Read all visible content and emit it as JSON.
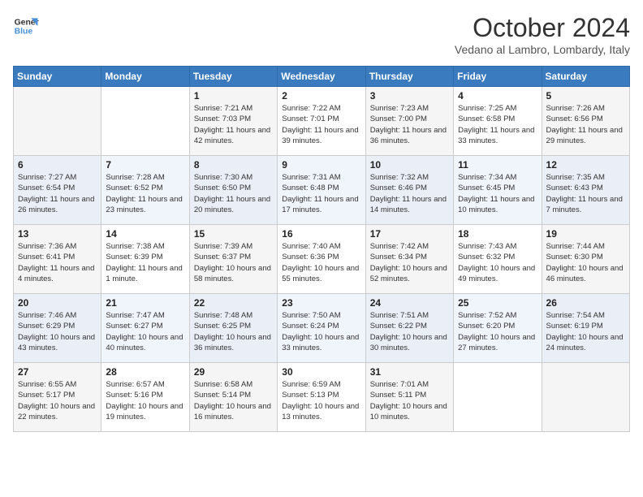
{
  "header": {
    "logo_line1": "General",
    "logo_line2": "Blue",
    "month": "October 2024",
    "location": "Vedano al Lambro, Lombardy, Italy"
  },
  "days_of_week": [
    "Sunday",
    "Monday",
    "Tuesday",
    "Wednesday",
    "Thursday",
    "Friday",
    "Saturday"
  ],
  "weeks": [
    [
      {
        "day": "",
        "info": ""
      },
      {
        "day": "",
        "info": ""
      },
      {
        "day": "1",
        "info": "Sunrise: 7:21 AM\nSunset: 7:03 PM\nDaylight: 11 hours and 42 minutes."
      },
      {
        "day": "2",
        "info": "Sunrise: 7:22 AM\nSunset: 7:01 PM\nDaylight: 11 hours and 39 minutes."
      },
      {
        "day": "3",
        "info": "Sunrise: 7:23 AM\nSunset: 7:00 PM\nDaylight: 11 hours and 36 minutes."
      },
      {
        "day": "4",
        "info": "Sunrise: 7:25 AM\nSunset: 6:58 PM\nDaylight: 11 hours and 33 minutes."
      },
      {
        "day": "5",
        "info": "Sunrise: 7:26 AM\nSunset: 6:56 PM\nDaylight: 11 hours and 29 minutes."
      }
    ],
    [
      {
        "day": "6",
        "info": "Sunrise: 7:27 AM\nSunset: 6:54 PM\nDaylight: 11 hours and 26 minutes."
      },
      {
        "day": "7",
        "info": "Sunrise: 7:28 AM\nSunset: 6:52 PM\nDaylight: 11 hours and 23 minutes."
      },
      {
        "day": "8",
        "info": "Sunrise: 7:30 AM\nSunset: 6:50 PM\nDaylight: 11 hours and 20 minutes."
      },
      {
        "day": "9",
        "info": "Sunrise: 7:31 AM\nSunset: 6:48 PM\nDaylight: 11 hours and 17 minutes."
      },
      {
        "day": "10",
        "info": "Sunrise: 7:32 AM\nSunset: 6:46 PM\nDaylight: 11 hours and 14 minutes."
      },
      {
        "day": "11",
        "info": "Sunrise: 7:34 AM\nSunset: 6:45 PM\nDaylight: 11 hours and 10 minutes."
      },
      {
        "day": "12",
        "info": "Sunrise: 7:35 AM\nSunset: 6:43 PM\nDaylight: 11 hours and 7 minutes."
      }
    ],
    [
      {
        "day": "13",
        "info": "Sunrise: 7:36 AM\nSunset: 6:41 PM\nDaylight: 11 hours and 4 minutes."
      },
      {
        "day": "14",
        "info": "Sunrise: 7:38 AM\nSunset: 6:39 PM\nDaylight: 11 hours and 1 minute."
      },
      {
        "day": "15",
        "info": "Sunrise: 7:39 AM\nSunset: 6:37 PM\nDaylight: 10 hours and 58 minutes."
      },
      {
        "day": "16",
        "info": "Sunrise: 7:40 AM\nSunset: 6:36 PM\nDaylight: 10 hours and 55 minutes."
      },
      {
        "day": "17",
        "info": "Sunrise: 7:42 AM\nSunset: 6:34 PM\nDaylight: 10 hours and 52 minutes."
      },
      {
        "day": "18",
        "info": "Sunrise: 7:43 AM\nSunset: 6:32 PM\nDaylight: 10 hours and 49 minutes."
      },
      {
        "day": "19",
        "info": "Sunrise: 7:44 AM\nSunset: 6:30 PM\nDaylight: 10 hours and 46 minutes."
      }
    ],
    [
      {
        "day": "20",
        "info": "Sunrise: 7:46 AM\nSunset: 6:29 PM\nDaylight: 10 hours and 43 minutes."
      },
      {
        "day": "21",
        "info": "Sunrise: 7:47 AM\nSunset: 6:27 PM\nDaylight: 10 hours and 40 minutes."
      },
      {
        "day": "22",
        "info": "Sunrise: 7:48 AM\nSunset: 6:25 PM\nDaylight: 10 hours and 36 minutes."
      },
      {
        "day": "23",
        "info": "Sunrise: 7:50 AM\nSunset: 6:24 PM\nDaylight: 10 hours and 33 minutes."
      },
      {
        "day": "24",
        "info": "Sunrise: 7:51 AM\nSunset: 6:22 PM\nDaylight: 10 hours and 30 minutes."
      },
      {
        "day": "25",
        "info": "Sunrise: 7:52 AM\nSunset: 6:20 PM\nDaylight: 10 hours and 27 minutes."
      },
      {
        "day": "26",
        "info": "Sunrise: 7:54 AM\nSunset: 6:19 PM\nDaylight: 10 hours and 24 minutes."
      }
    ],
    [
      {
        "day": "27",
        "info": "Sunrise: 6:55 AM\nSunset: 5:17 PM\nDaylight: 10 hours and 22 minutes."
      },
      {
        "day": "28",
        "info": "Sunrise: 6:57 AM\nSunset: 5:16 PM\nDaylight: 10 hours and 19 minutes."
      },
      {
        "day": "29",
        "info": "Sunrise: 6:58 AM\nSunset: 5:14 PM\nDaylight: 10 hours and 16 minutes."
      },
      {
        "day": "30",
        "info": "Sunrise: 6:59 AM\nSunset: 5:13 PM\nDaylight: 10 hours and 13 minutes."
      },
      {
        "day": "31",
        "info": "Sunrise: 7:01 AM\nSunset: 5:11 PM\nDaylight: 10 hours and 10 minutes."
      },
      {
        "day": "",
        "info": ""
      },
      {
        "day": "",
        "info": ""
      }
    ]
  ]
}
